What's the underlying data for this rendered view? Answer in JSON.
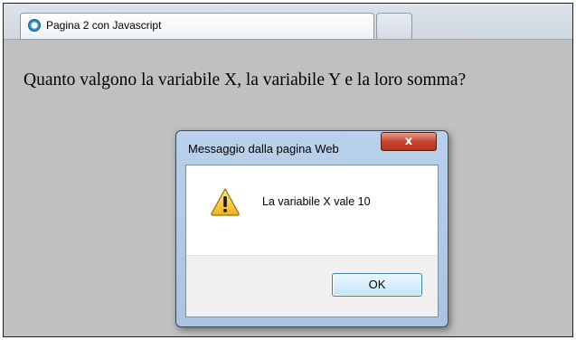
{
  "browser": {
    "tab_title": "Pagina 2 con Javascript",
    "tab_icon": "ie-page-icon"
  },
  "page": {
    "question": "Quanto valgono la variabile X, la variabile Y e la loro somma?",
    "background": "#c0c0c0"
  },
  "dialog": {
    "title": "Messaggio dalla pagina Web",
    "close_label": "x",
    "message": "La variabile X vale 10",
    "icon": "warning-icon",
    "ok_label": "OK"
  }
}
